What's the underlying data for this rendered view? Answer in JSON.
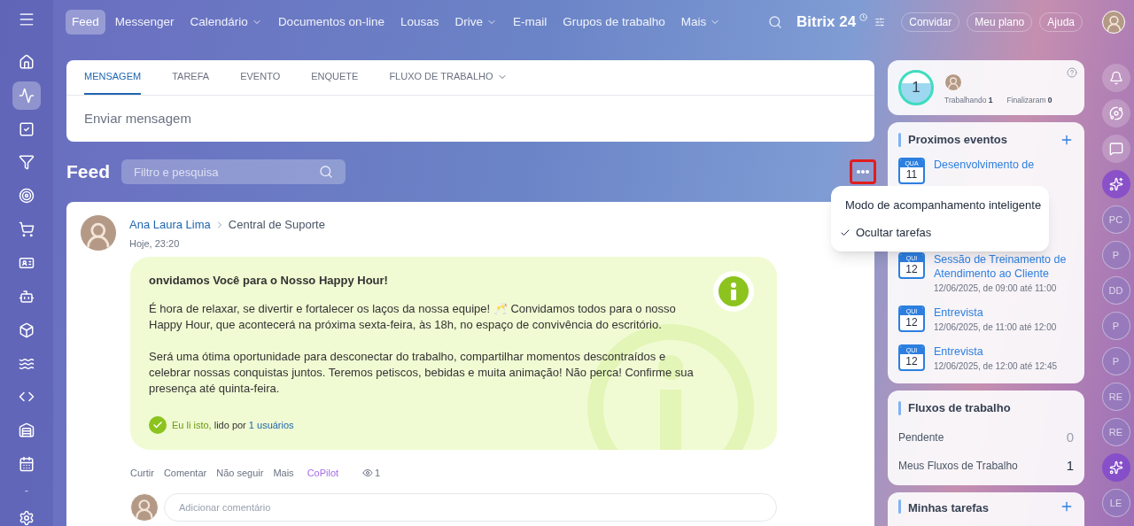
{
  "top_nav": {
    "items": [
      {
        "label": "Feed",
        "selected": true,
        "dropdown": false
      },
      {
        "label": "Messenger",
        "selected": false,
        "dropdown": false
      },
      {
        "label": "Calendário",
        "selected": false,
        "dropdown": true
      },
      {
        "label": "Documentos on-line",
        "selected": false,
        "dropdown": false
      },
      {
        "label": "Lousas",
        "selected": false,
        "dropdown": false
      },
      {
        "label": "Drive",
        "selected": false,
        "dropdown": true
      },
      {
        "label": "E-mail",
        "selected": false,
        "dropdown": false
      },
      {
        "label": "Grupos de trabalho",
        "selected": false,
        "dropdown": false
      },
      {
        "label": "Mais",
        "selected": false,
        "dropdown": true
      }
    ],
    "logo": {
      "name": "Bitrix",
      "number": "24"
    },
    "buttons": [
      "Convidar",
      "Meu plano",
      "Ajuda"
    ]
  },
  "sidebar": {
    "items": [
      {
        "kind": "home",
        "selected": false
      },
      {
        "kind": "activity",
        "selected": true
      },
      {
        "kind": "tasks",
        "selected": false
      },
      {
        "kind": "crm",
        "selected": false
      },
      {
        "kind": "target",
        "selected": false
      },
      {
        "kind": "cart",
        "selected": false
      },
      {
        "kind": "card",
        "selected": false
      },
      {
        "kind": "bot",
        "selected": false
      },
      {
        "kind": "box",
        "selected": false
      },
      {
        "kind": "waves",
        "selected": false
      },
      {
        "kind": "code",
        "selected": false
      },
      {
        "kind": "store",
        "selected": false
      },
      {
        "kind": "calendar",
        "selected": false
      }
    ],
    "separator": "-"
  },
  "composer": {
    "tabs": [
      {
        "label": "MENSAGEM",
        "selected": true,
        "dropdown": false
      },
      {
        "label": "TAREFA",
        "selected": false,
        "dropdown": false
      },
      {
        "label": "EVENTO",
        "selected": false,
        "dropdown": false
      },
      {
        "label": "ENQUETE",
        "selected": false,
        "dropdown": false
      },
      {
        "label": "FLUXO DE TRABALHO",
        "selected": false,
        "dropdown": true
      }
    ],
    "placeholder": "Enviar mensagem"
  },
  "feed": {
    "title": "Feed",
    "search_placeholder": "Filtro e pesquisa",
    "more_highlighted": true
  },
  "menu": {
    "items": [
      {
        "label": "Modo de acompanhamento inteligente",
        "checked": false
      },
      {
        "label": "Ocultar tarefas",
        "checked": true
      }
    ]
  },
  "post": {
    "author": "Ana Laura Lima",
    "destination": "Central de Suporte",
    "time": "Hoje, 23:20",
    "title": "onvidamos Você para o Nosso Happy Hour!",
    "paragraphs": [
      "É hora de relaxar, se divertir e fortalecer os laços da nossa equipe! 🥂 Convidamos todos para o nosso Happy Hour, que acontecerá na próxima sexta-feira, às 18h, no espaço de convivência do escritório.",
      "Será uma ótima oportunidade para desconectar do trabalho, compartilhar momentos descontraídos e celebrar nossas conquistas juntos. Teremos petiscos, bebidas e muita animação! Não perca! Confirme sua presença até quinta-feira."
    ],
    "read_confirmed": true,
    "read_label": "Eu li isto,",
    "read_by": "lido por",
    "read_users": "1 usuários",
    "actions": [
      {
        "label": "Curtir",
        "kind": "plain"
      },
      {
        "label": "Comentar",
        "kind": "plain"
      },
      {
        "label": "Não seguir",
        "kind": "plain"
      },
      {
        "label": "Mais",
        "kind": "plain"
      },
      {
        "label": "CoPilot",
        "kind": "copilot"
      }
    ],
    "views": "1",
    "comment_placeholder": "Adicionar comentário"
  },
  "worktime": {
    "count": "1",
    "working_label": "Trabalhando",
    "working": "1",
    "finished_label": "Finalizaram",
    "finished": "0"
  },
  "events": {
    "title": "Proximos eventos",
    "items": [
      {
        "weekday": "QUA",
        "day": "11",
        "title": "Desenvolvimento de"
      },
      {
        "weekday": "QUI",
        "day": "12",
        "title": "Sessão de Treinamento de Atendimento ao Cliente",
        "when": "12/06/2025, de 09:00 até 11:00"
      },
      {
        "weekday": "QUI",
        "day": "12",
        "title": "Entrevista",
        "when": "12/06/2025, de 11:00 até 12:00"
      },
      {
        "weekday": "QUI",
        "day": "12",
        "title": "Entrevista",
        "when": "12/06/2025, de 12:00 até 12:45"
      }
    ]
  },
  "workflows": {
    "title": "Fluxos de trabalho",
    "rows": [
      {
        "label": "Pendente",
        "count": "0",
        "zero": true
      },
      {
        "label": "Meus Fluxos de Trabalho",
        "count": "1",
        "zero": false
      }
    ]
  },
  "tasks": {
    "title": "Minhas tarefas"
  },
  "rail": {
    "items": [
      {
        "kind": "bell"
      },
      {
        "kind": "spiral"
      },
      {
        "kind": "chat"
      },
      {
        "kind": "copilot"
      },
      {
        "kind": "user",
        "initials": "PC"
      },
      {
        "kind": "user",
        "initials": "P"
      },
      {
        "kind": "user",
        "initials": "DD"
      },
      {
        "kind": "user",
        "initials": "P"
      },
      {
        "kind": "user",
        "initials": "P"
      },
      {
        "kind": "user",
        "initials": "RE"
      },
      {
        "kind": "user",
        "initials": "RE"
      },
      {
        "kind": "copilot"
      },
      {
        "kind": "user",
        "initials": "LE"
      }
    ]
  }
}
